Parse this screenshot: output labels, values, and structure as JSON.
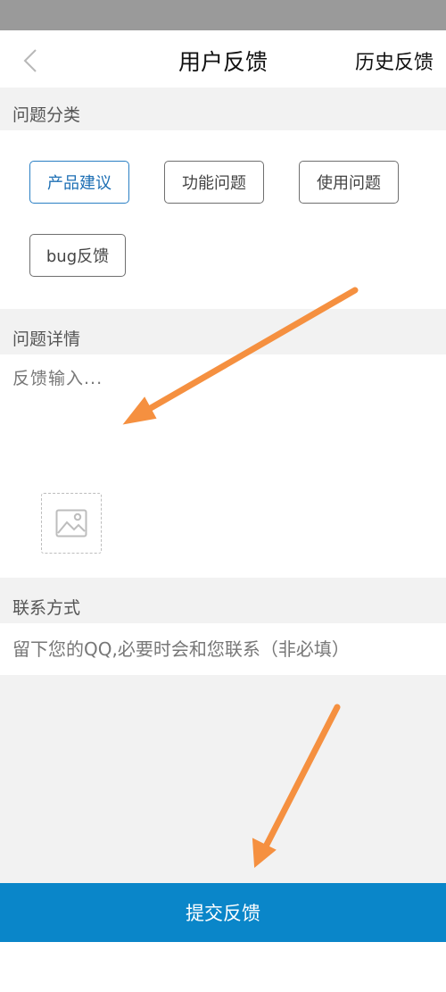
{
  "header": {
    "title": "用户反馈",
    "history_label": "历史反馈",
    "back_icon": "chevron-left-icon"
  },
  "category": {
    "section_label": "问题分类",
    "options": [
      {
        "label": "产品建议",
        "selected": true
      },
      {
        "label": "功能问题",
        "selected": false
      },
      {
        "label": "使用问题",
        "selected": false
      },
      {
        "label": "bug反馈",
        "selected": false
      }
    ]
  },
  "detail": {
    "section_label": "问题详情",
    "placeholder": "反馈输入...",
    "add_image_icon": "image-icon"
  },
  "contact": {
    "section_label": "联系方式",
    "placeholder": "留下您的QQ,必要时会和您联系（非必填）"
  },
  "submit": {
    "label": "提交反馈"
  },
  "colors": {
    "accent": "#0a86c9",
    "selected_chip": "#2a7fc4",
    "annotation_arrow": "#f59040"
  }
}
